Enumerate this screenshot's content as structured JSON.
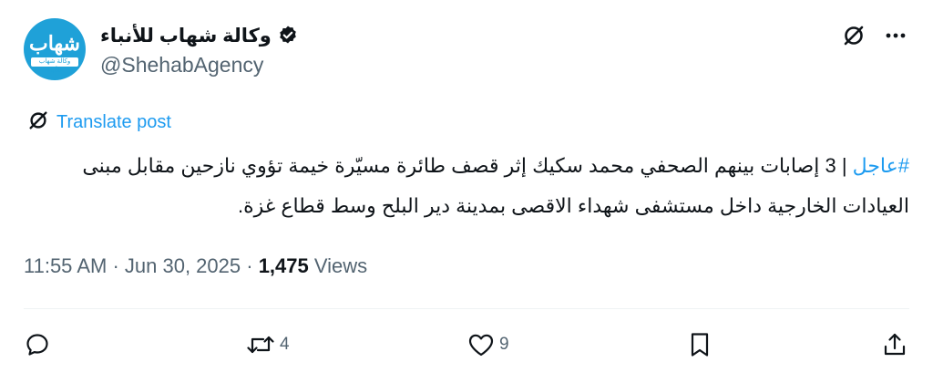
{
  "account": {
    "display_name": "وكالة شهاب للأنباء",
    "handle": "@ShehabAgency",
    "avatar_text": "شهاب",
    "avatar_subtext": "وكالة شهاب للأنباء"
  },
  "translate_label": "Translate post",
  "tweet": {
    "hashtag": "#عاجل",
    "body": " | 3 إصابات بينهم الصحفي محمد سكيك إثر قصف طائرة مسيّرة خيمة تؤوي نازحين مقابل مبنى العيادات الخارجية داخل مستشفى شهداء الاقصى بمدينة دير البلح وسط قطاع غزة."
  },
  "meta": {
    "time": "11:55 AM",
    "sep1": " · ",
    "date": "Jun 30, 2025",
    "sep2": " · ",
    "views_count": "1,475",
    "views_label": " Views"
  },
  "actions": {
    "reply_count": "",
    "retweet_count": "4",
    "like_count": "9"
  },
  "icons": {
    "verified": "verified-badge-icon",
    "grok": "grok-icon",
    "more": "more-icon",
    "reply": "reply-icon",
    "retweet": "retweet-icon",
    "like": "like-icon",
    "bookmark": "bookmark-icon",
    "share": "share-icon"
  },
  "colors": {
    "accent": "#1d9bf0",
    "text": "#0f1419",
    "secondary": "#536471",
    "avatar_bg": "#1fa1d8"
  }
}
